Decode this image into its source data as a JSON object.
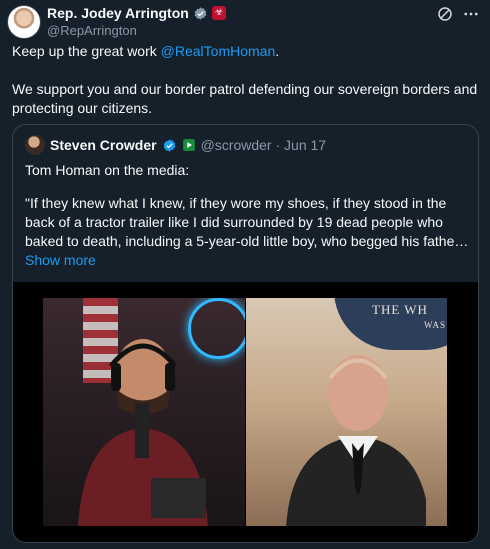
{
  "post": {
    "author_name": "Rep. Jodey Arrington",
    "author_handle": "@RepArrington",
    "text_prefix": "Keep up the great work ",
    "mention": "@RealTomHoman",
    "text_suffix": ".",
    "text_second": "We support you and our border patrol defending our sovereign borders and protecting our citizens."
  },
  "quote": {
    "author_name": "Steven Crowder",
    "author_meta": "@scrowder · Jun 17",
    "line1": "Tom Homan on the media:",
    "line2": "\"If they knew what I knew, if they wore my shoes, if they stood in the back of a tractor trailer like I did surrounded by 19 dead people who baked to death, including a 5-year-old little boy, who begged his fathe…",
    "show_more": "Show more"
  },
  "media": {
    "seal_line1": "THE WH",
    "seal_line2": "WAS"
  },
  "icons": [
    "verified-badge-icon",
    "gov-flag-icon",
    "grok-icon",
    "more-icon",
    "play-badge-icon"
  ],
  "colors": {
    "bg": "#15202b",
    "link": "#1d9bf0",
    "muted": "#8b98a5"
  }
}
